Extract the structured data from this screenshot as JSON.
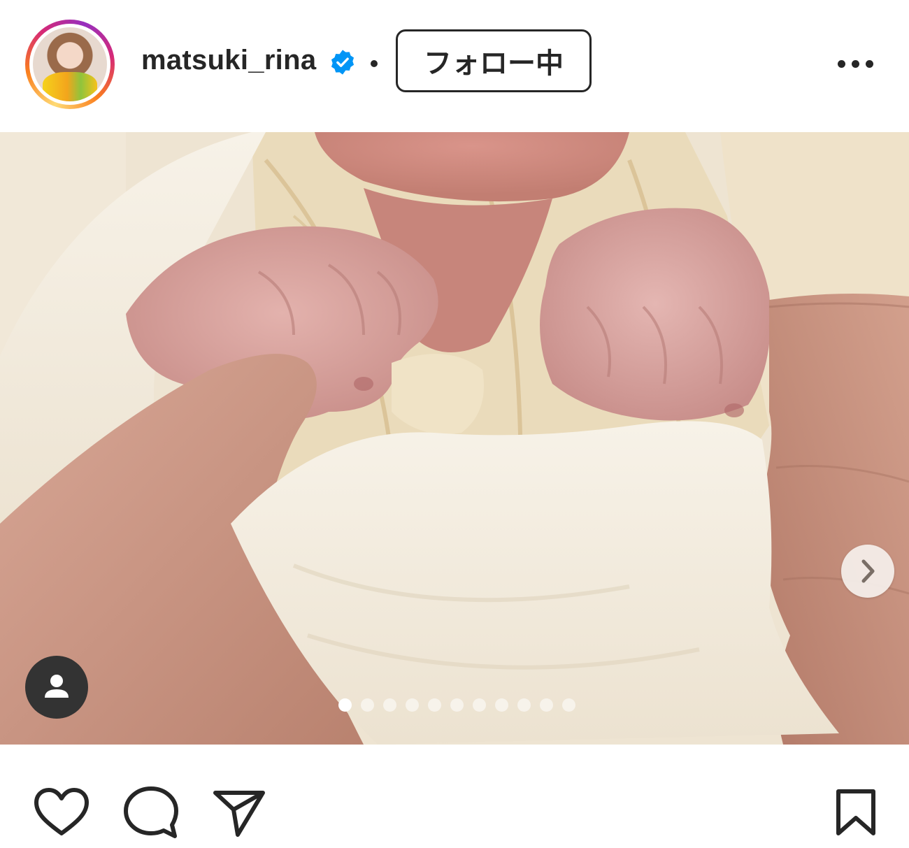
{
  "post_header": {
    "username": "matsuki_rina",
    "separator": "•",
    "follow_button_label": "フォロー中",
    "verified_icon": "verified-badge-icon",
    "more_icon": "more-options-icon"
  },
  "media": {
    "description_icon": "tagged-user-icon",
    "next_icon": "chevron-right-icon",
    "carousel_total": 11,
    "carousel_current": 1
  },
  "actions": {
    "like_icon": "heart-icon",
    "comment_icon": "comment-icon",
    "share_icon": "send-icon",
    "save_icon": "bookmark-icon"
  },
  "colors": {
    "text": "#262626",
    "verified": "#0095f6",
    "dot_inactive": "rgba(255,255,255,0.55)",
    "dot_active": "#ffffff"
  }
}
